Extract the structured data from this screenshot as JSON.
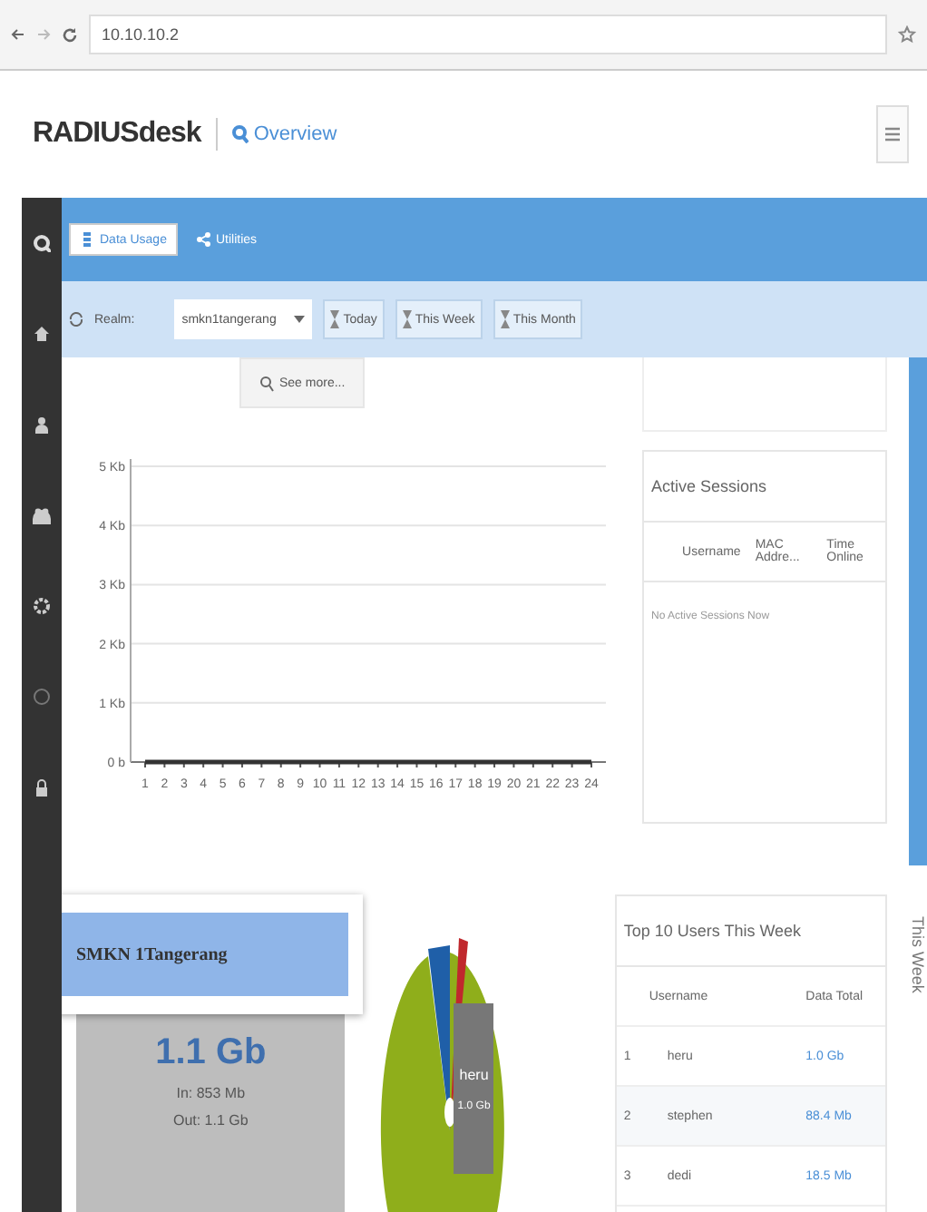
{
  "browser": {
    "url": "10.10.10.2"
  },
  "header": {
    "brand": "RADIUSdesk",
    "page": "Overview"
  },
  "tabs": [
    {
      "label": "Data Usage",
      "selected": true
    },
    {
      "label": "Utilities",
      "selected": false
    }
  ],
  "toolbar": {
    "realm_label": "Realm:",
    "realm_value": "smkn1tangerang",
    "buttons": [
      "Today",
      "This Week",
      "This Month"
    ]
  },
  "see_more": "See more...",
  "usage_chart": {
    "chart_data": {
      "type": "line",
      "x": [
        1,
        2,
        3,
        4,
        5,
        6,
        7,
        8,
        9,
        10,
        11,
        12,
        13,
        14,
        15,
        16,
        17,
        18,
        19,
        20,
        21,
        22,
        23,
        24
      ],
      "ylim": [
        0,
        5
      ],
      "grid": true,
      "yticks": [
        {
          "value": 0,
          "label": "0 b"
        },
        {
          "value": 1,
          "label": "1 Kb"
        },
        {
          "value": 2,
          "label": "2 Kb"
        },
        {
          "value": 3,
          "label": "3 Kb"
        },
        {
          "value": 4,
          "label": "4 Kb"
        },
        {
          "value": 5,
          "label": "5 Kb"
        }
      ],
      "series": [
        {
          "color": "#333333",
          "values": [
            0,
            0,
            0,
            0,
            0,
            0,
            0,
            0,
            0,
            0,
            0,
            0,
            0,
            0,
            0,
            0,
            0,
            0,
            0,
            0,
            0,
            0,
            0,
            0
          ]
        }
      ]
    }
  },
  "active_sessions": {
    "title": "Active Sessions",
    "columns": [
      "Username",
      "MAC Addre...",
      "Time Online"
    ],
    "empty": "No Active Sessions Now"
  },
  "summary": {
    "total": "1.1 Gb",
    "in": "In: 853 Mb",
    "out": "Out: 1.1 Gb"
  },
  "popup": {
    "label": "SMKN 1Tangerang"
  },
  "pie_tooltip": {
    "name": "heru",
    "value": "1.0 Gb"
  },
  "top_users": {
    "title": "Top 10 Users This Week",
    "columns": [
      "Username",
      "Data Total"
    ],
    "rows": [
      {
        "rank": "1",
        "username": "heru",
        "total": "1.0 Gb"
      },
      {
        "rank": "2",
        "username": "stephen",
        "total": "88.4 Mb"
      },
      {
        "rank": "3",
        "username": "dedi",
        "total": "18.5 Mb"
      }
    ]
  },
  "side_label": "This Week"
}
